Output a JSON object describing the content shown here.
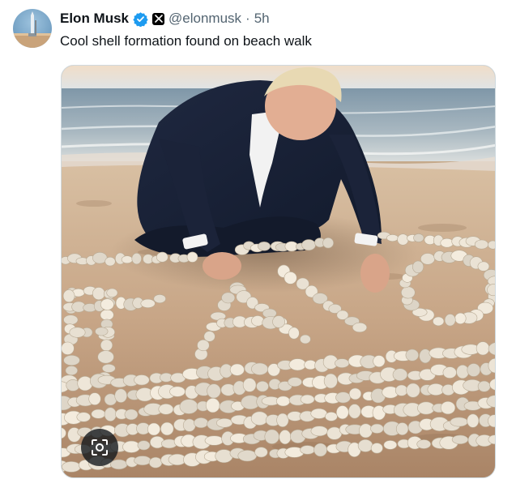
{
  "tweet": {
    "author_name": "Elon Musk",
    "handle": "@elonmusk",
    "separator": "·",
    "time": "5h",
    "text": "Cool shell formation found on beach walk",
    "verified_icon": "verified-badge-icon",
    "affiliate_icon": "x-logo-icon"
  },
  "media": {
    "shell_text": "PAID",
    "lens_icon": "image-search-icon"
  },
  "colors": {
    "verified": "#1d9bf0",
    "text": "#0f1419",
    "muted": "#536471",
    "border": "#cfd9de"
  }
}
